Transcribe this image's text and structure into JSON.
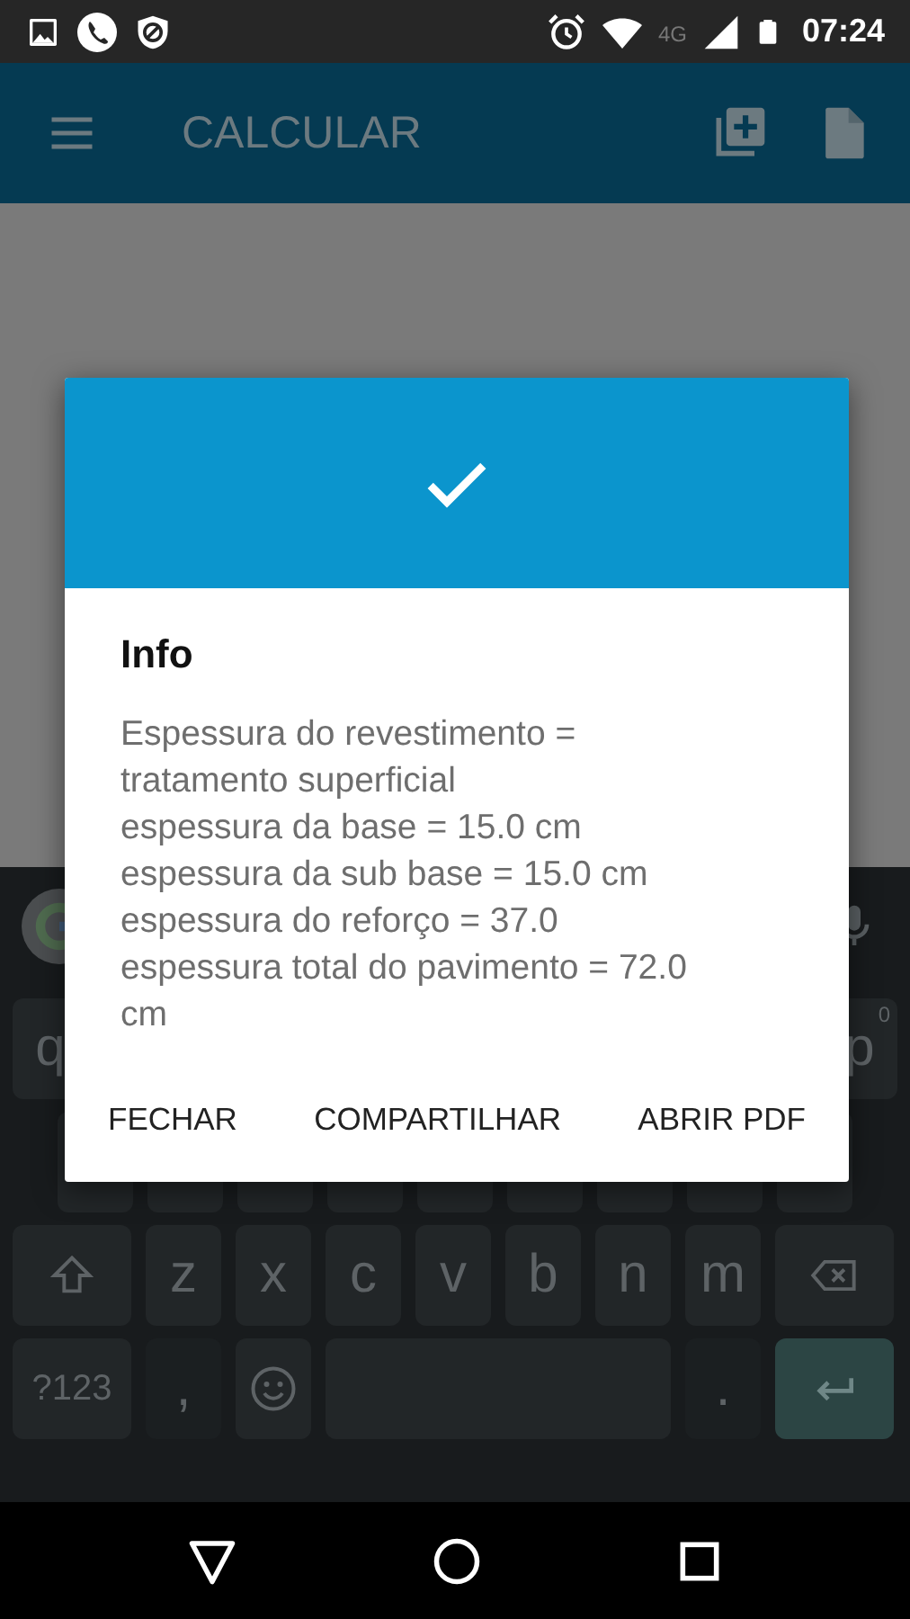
{
  "status_bar": {
    "network": "4G",
    "time": "07:24"
  },
  "app_bar": {
    "title": "CALCULAR"
  },
  "keyboard": {
    "row_1": {
      "left": "q",
      "right": "p",
      "right_hint": "0"
    },
    "row_3": [
      "z",
      "x",
      "c",
      "v",
      "b",
      "n",
      "m"
    ],
    "row_4": {
      "symbols": "?123",
      "comma": ",",
      "period": "."
    }
  },
  "dialog": {
    "title": "Info",
    "message": "Espessura do revestimento = tratamento superficial\nespessura da base = 15.0 cm\nespessura da sub base = 15.0 cm\nespessura do reforço = 37.0\nespessura total do pavimento = 72.0 cm",
    "buttons": [
      "FECHAR",
      "COMPARTILHAR",
      "ABRIR PDF"
    ]
  }
}
